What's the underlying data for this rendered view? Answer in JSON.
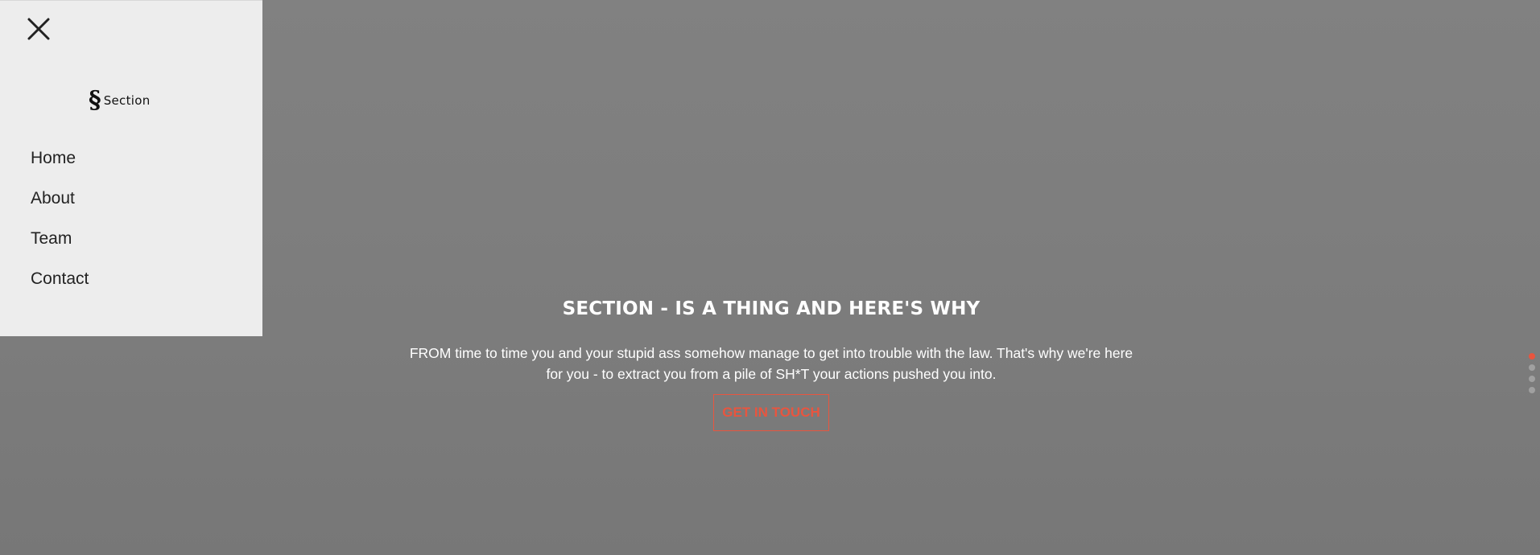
{
  "hero": {
    "title": "SECTION - IS A THING AND HERE'S WHY",
    "text": "FROM time to time you and your stupid ass somehow manage to get into trouble with the law. That's why we're here for you - to extract you from a pile of SH*T your actions pushed you into.",
    "cta_label": "GET IN TOUCH"
  },
  "menu": {
    "logo_mark": "§",
    "logo_text": "Section",
    "items": [
      {
        "label": "Home"
      },
      {
        "label": "About"
      },
      {
        "label": "Team"
      },
      {
        "label": "Contact"
      }
    ]
  },
  "slider": {
    "dot_count": 4,
    "active_index": 0
  },
  "colors": {
    "accent": "#e8553f",
    "menu_bg": "#ededed",
    "overlay": "#7f7f7f"
  },
  "icons": {
    "close": "close-icon"
  }
}
